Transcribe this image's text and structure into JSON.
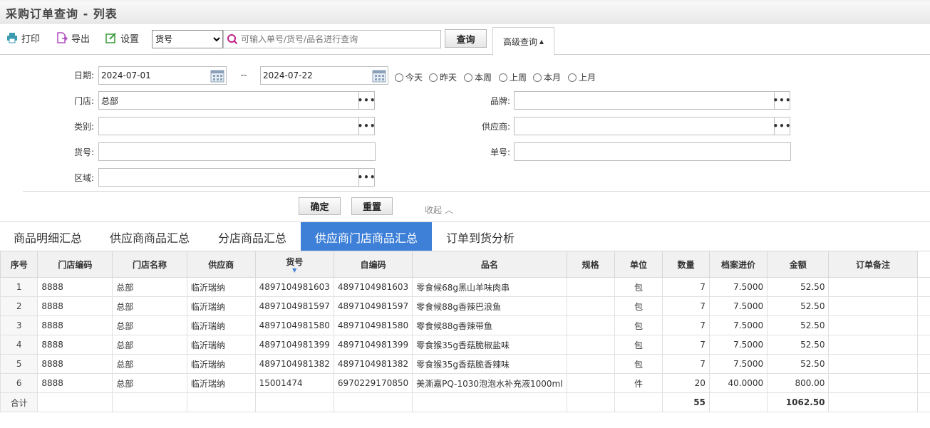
{
  "window": {
    "title": "采购订单查询 - 列表"
  },
  "toolbar": {
    "print_label": "打印",
    "export_label": "导出",
    "settings_label": "设置",
    "field_select_value": "货号",
    "search_placeholder": "可输入单号/货号/品名进行查询",
    "query_label": "查询",
    "advanced_label": "高级查询"
  },
  "filters": {
    "date_label": "日期:",
    "date_from": "2024-07-01",
    "date_sep": "--",
    "date_to": "2024-07-22",
    "quick_dates": [
      "今天",
      "昨天",
      "本周",
      "上周",
      "本月",
      "上月"
    ],
    "store_label": "门店:",
    "store_value": "总部",
    "brand_label": "品牌:",
    "brand_value": "",
    "category_label": "类别:",
    "category_value": "",
    "supplier_label": "供应商:",
    "supplier_value": "",
    "item_no_label": "货号:",
    "item_no_value": "",
    "order_no_label": "单号:",
    "order_no_value": "",
    "region_label": "区域:",
    "region_value": "",
    "confirm_label": "确定",
    "reset_label": "重置",
    "collapse_label": "收起"
  },
  "tabs": [
    "商品明细汇总",
    "供应商商品汇总",
    "分店商品汇总",
    "供应商门店商品汇总",
    "订单到货分析"
  ],
  "active_tab": 3,
  "table": {
    "columns": [
      "序号",
      "门店编码",
      "门店名称",
      "供应商",
      "货号",
      "自编码",
      "品名",
      "规格",
      "单位",
      "数量",
      "档案进价",
      "金额",
      "订单备注"
    ],
    "rows": [
      [
        "1",
        "8888",
        "总部",
        "临沂瑞纳",
        "4897104981603",
        "4897104981603",
        "零食候68g黑山羊味肉串",
        "",
        "包",
        "7",
        "7.5000",
        "52.50",
        ""
      ],
      [
        "2",
        "8888",
        "总部",
        "临沂瑞纳",
        "4897104981597",
        "4897104981597",
        "零食候88g香辣巴浪鱼",
        "",
        "包",
        "7",
        "7.5000",
        "52.50",
        ""
      ],
      [
        "3",
        "8888",
        "总部",
        "临沂瑞纳",
        "4897104981580",
        "4897104981580",
        "零食候88g香辣带鱼",
        "",
        "包",
        "7",
        "7.5000",
        "52.50",
        ""
      ],
      [
        "4",
        "8888",
        "总部",
        "临沂瑞纳",
        "4897104981399",
        "4897104981399",
        "零食猴35g香菇脆椒盐味",
        "",
        "包",
        "7",
        "7.5000",
        "52.50",
        ""
      ],
      [
        "5",
        "8888",
        "总部",
        "临沂瑞纳",
        "4897104981382",
        "4897104981382",
        "零食猴35g香菇脆香辣味",
        "",
        "包",
        "7",
        "7.5000",
        "52.50",
        ""
      ],
      [
        "6",
        "8888",
        "总部",
        "临沂瑞纳",
        "15001474",
        "6970229170850",
        "美澌嘉PQ-1030泡泡水补充液1000ml",
        "",
        "件",
        "20",
        "40.0000",
        "800.00",
        ""
      ]
    ],
    "total_label": "合计",
    "total_qty": "55",
    "total_amount": "1062.50"
  },
  "colors": {
    "accent": "#3e80d8",
    "print_icon": "#3a9ab0",
    "export_icon": "#b04fc0",
    "settings_icon": "#3a9a3a",
    "search_icon": "#c0208a"
  }
}
